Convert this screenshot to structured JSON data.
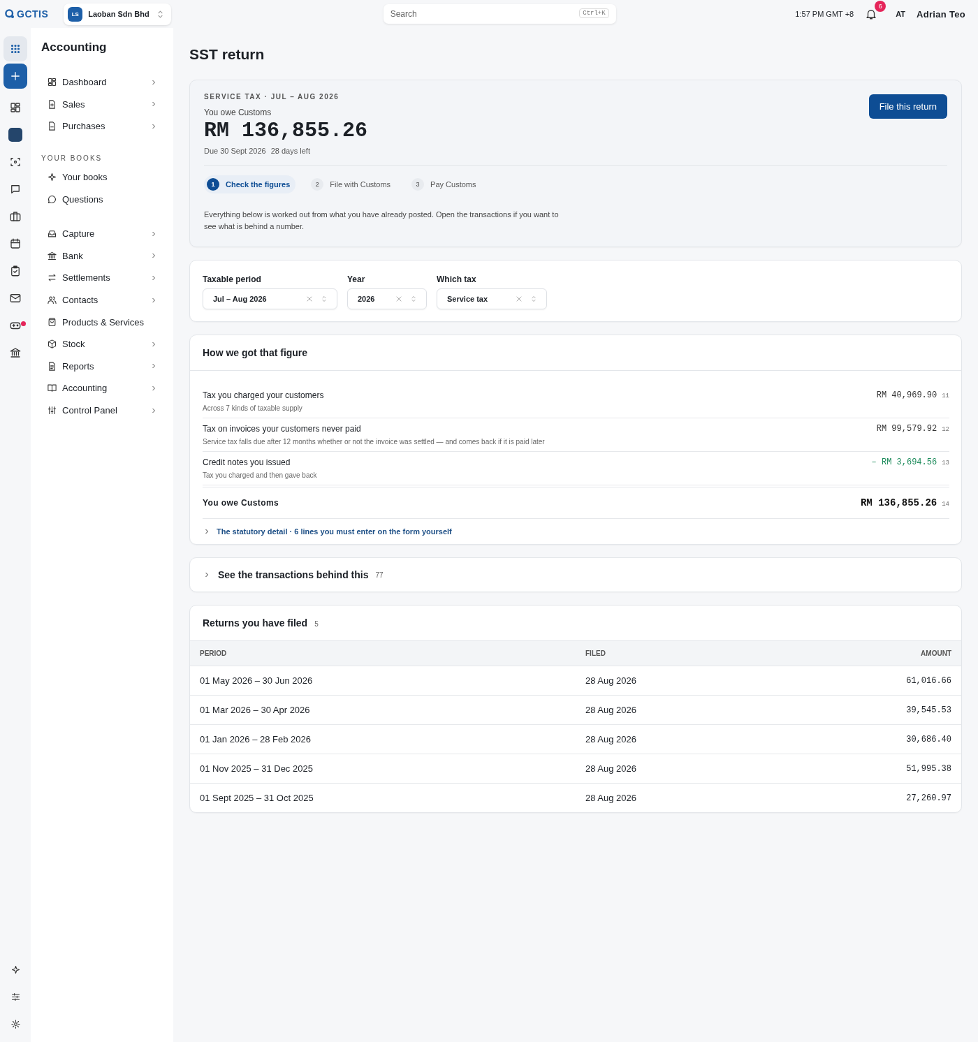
{
  "topbar": {
    "logo": "GCTIS",
    "company": {
      "initials": "LS",
      "name": "Laoban Sdn Bhd"
    },
    "search": {
      "placeholder": "Search",
      "shortcut": "Ctrl+K"
    },
    "time": "1:57 PM GMT +8",
    "notifications": "6",
    "user": {
      "initials": "AT",
      "name": "Adrian Teo"
    }
  },
  "rail": {
    "alert_dot": true
  },
  "sidebar": {
    "title": "Accounting",
    "groups": [
      {
        "items": [
          {
            "label": "Dashboard",
            "submenu": true
          },
          {
            "label": "Sales",
            "submenu": true
          },
          {
            "label": "Purchases",
            "submenu": true
          }
        ]
      },
      {
        "heading": "YOUR BOOKS",
        "items": [
          {
            "label": "Your books",
            "submenu": false
          },
          {
            "label": "Questions",
            "submenu": false
          }
        ]
      },
      {
        "items": [
          {
            "label": "Capture",
            "submenu": true
          },
          {
            "label": "Bank",
            "submenu": true
          },
          {
            "label": "Settlements",
            "submenu": true
          },
          {
            "label": "Contacts",
            "submenu": true
          },
          {
            "label": "Products & Services",
            "submenu": false
          },
          {
            "label": "Stock",
            "submenu": true
          },
          {
            "label": "Reports",
            "submenu": true
          },
          {
            "label": "Accounting",
            "submenu": true
          },
          {
            "label": "Control Panel",
            "submenu": true
          }
        ]
      }
    ]
  },
  "page": {
    "title": "SST return"
  },
  "summary": {
    "eyebrow": "SERVICE TAX · JUL – AUG 2026",
    "owe_label": "You owe Customs",
    "amount": "RM 136,855.26",
    "due": "Due 30 Sept 2026",
    "days_left": "28 days left",
    "action": "File this return",
    "steps": [
      {
        "number": "1",
        "label": "Check the figures",
        "selected": true
      },
      {
        "number": "2",
        "label": "File with Customs",
        "selected": false
      },
      {
        "number": "3",
        "label": "Pay Customs",
        "selected": false
      }
    ],
    "note": "Everything below is worked out from what you have already posted. Open the transactions if you want to see what is behind a number."
  },
  "filters": [
    {
      "label": "Taxable period",
      "value": "Jul – Aug 2026"
    },
    {
      "label": "Year",
      "value": "2026"
    },
    {
      "label": "Which tax",
      "value": "Service tax"
    }
  ],
  "breakdown": {
    "title": "How we got that figure",
    "lines": [
      {
        "kind": "charge",
        "label": "Tax you charged your customers",
        "note": "Across 7 kinds of taxable supply",
        "amount": "RM 40,969.90",
        "ref": "11"
      },
      {
        "kind": "charge",
        "label": "Tax on invoices your customers never paid",
        "note": "Service tax falls due after 12 months whether or not the invoice was settled — and comes back if it is paid later",
        "amount": "RM 99,579.92",
        "ref": "12"
      },
      {
        "kind": "credit",
        "label": "Credit notes you issued",
        "note": "Tax you charged and then gave back",
        "amount": "– RM 3,694.56",
        "ref": "13"
      }
    ],
    "total": {
      "label": "You owe Customs",
      "amount": "RM 136,855.26",
      "ref": "14"
    },
    "detail_link": "The statutory detail · 6 lines you must enter on the form yourself",
    "detail_expanded": false
  },
  "transactions": {
    "title": "See the transactions behind this",
    "count": "77",
    "expanded": false
  },
  "returns": {
    "title": "Returns you have filed",
    "count": "5",
    "columns": [
      "PERIOD",
      "FILED",
      "AMOUNT"
    ],
    "rows": [
      [
        "01 May 2026 – 30 Jun 2026",
        "28 Aug 2026",
        "61,016.66"
      ],
      [
        "01 Mar 2026 – 30 Apr 2026",
        "28 Aug 2026",
        "39,545.53"
      ],
      [
        "01 Jan 2026 – 28 Feb 2026",
        "28 Aug 2026",
        "30,686.40"
      ],
      [
        "01 Nov 2025 – 31 Dec 2025",
        "28 Aug 2026",
        "51,995.38"
      ],
      [
        "01 Sept 2025 – 31 Oct 2025",
        "28 Aug 2026",
        "27,260.97"
      ]
    ]
  }
}
